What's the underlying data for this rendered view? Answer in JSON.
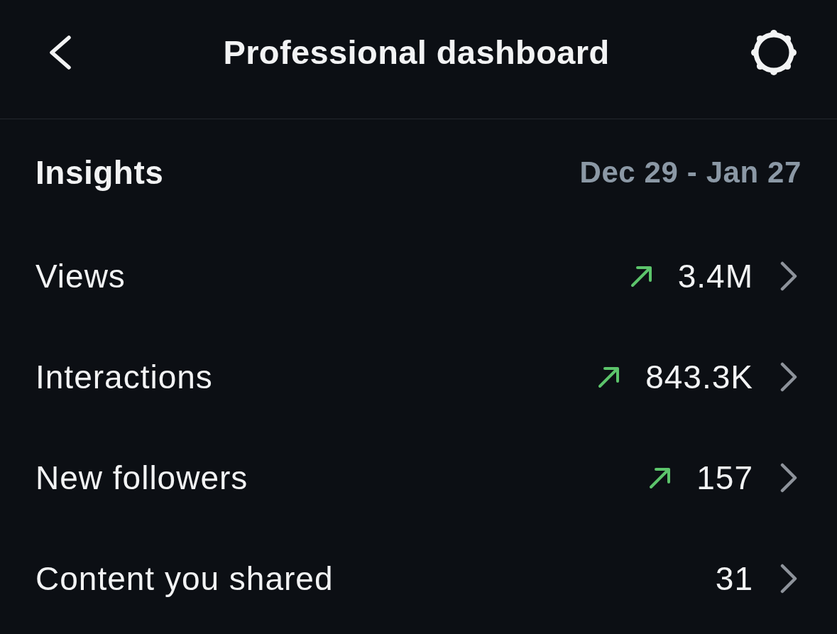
{
  "header": {
    "title": "Professional dashboard"
  },
  "insights": {
    "title": "Insights",
    "date_range": "Dec 29 - Jan 27"
  },
  "rows": [
    {
      "label": "Views",
      "value": "3.4M",
      "trending_up": true
    },
    {
      "label": "Interactions",
      "value": "843.3K",
      "trending_up": true
    },
    {
      "label": "New followers",
      "value": "157",
      "trending_up": true
    },
    {
      "label": "Content you shared",
      "value": "31",
      "trending_up": false
    }
  ]
}
